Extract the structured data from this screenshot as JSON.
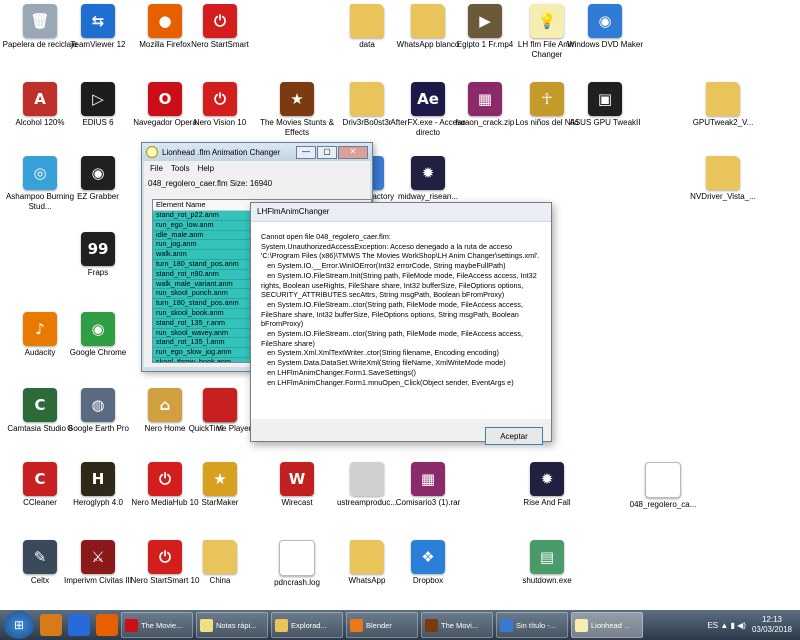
{
  "desktop_icons": [
    {
      "label": "Papelera de reciclaje",
      "color": "#9aa7b5",
      "glyph": "🗑",
      "col": 0,
      "row": 0,
      "shortcut": false
    },
    {
      "label": "TeamViewer 12",
      "color": "#1f6fd1",
      "glyph": "⇆",
      "col": 1,
      "row": 0,
      "shortcut": true
    },
    {
      "label": "Mozilla Firefox",
      "color": "#e66000",
      "glyph": "●",
      "col": 2,
      "row": 0,
      "shortcut": true
    },
    {
      "label": "Nero StartSmart",
      "color": "#d41d1d",
      "glyph": "⏻",
      "col": 3,
      "row": 0,
      "shortcut": true
    },
    {
      "label": "data",
      "color": "#e8c45a",
      "glyph": "",
      "col": 5,
      "row": 0,
      "folder": true
    },
    {
      "label": "WhatsApp blanco",
      "color": "#e8c45a",
      "glyph": "",
      "col": 6,
      "row": 0,
      "folder": true
    },
    {
      "label": "Egipto 1 Fr.mp4",
      "color": "#6b5a3a",
      "glyph": "▶",
      "col": 7,
      "row": 0
    },
    {
      "label": "LH flm File Anim Changer",
      "color": "#f5eeb0",
      "glyph": "💡",
      "col": 8,
      "row": 0
    },
    {
      "label": "Windows DVD Maker",
      "color": "#2f7bd6",
      "glyph": "◉",
      "col": 9,
      "row": 0,
      "shortcut": true
    },
    {
      "label": "Alcohol 120%",
      "color": "#c0302b",
      "glyph": "A",
      "col": 0,
      "row": 1,
      "shortcut": true
    },
    {
      "label": "EDIUS 6",
      "color": "#1d1d1d",
      "glyph": "▷",
      "col": 1,
      "row": 1,
      "shortcut": true
    },
    {
      "label": "Navegador Opera",
      "color": "#cc0f16",
      "glyph": "O",
      "col": 2,
      "row": 1,
      "shortcut": true
    },
    {
      "label": "Nero Vision 10",
      "color": "#d41d1d",
      "glyph": "⏻",
      "col": 3,
      "row": 1,
      "shortcut": true
    },
    {
      "label": "The Movies Stunts & Effects",
      "color": "#7b3a10",
      "glyph": "★",
      "col": 4,
      "row": 1,
      "shortcut": true
    },
    {
      "label": "Driv3rBo0st3r",
      "color": "#e8c45a",
      "glyph": "",
      "col": 5,
      "row": 1,
      "folder": true
    },
    {
      "label": "AfterFX.exe - Acceso directo",
      "color": "#1d1a4a",
      "glyph": "Ae",
      "col": 6,
      "row": 1,
      "shortcut": true
    },
    {
      "label": "faraon_crack.zip",
      "color": "#8a2a6a",
      "glyph": "▦",
      "col": 7,
      "row": 1
    },
    {
      "label": "Los niños del Nilo",
      "color": "#c49a2a",
      "glyph": "☥",
      "col": 8,
      "row": 1
    },
    {
      "label": "ASUS GPU TweakII",
      "color": "#202020",
      "glyph": "▣",
      "col": 9,
      "row": 1,
      "shortcut": true
    },
    {
      "label": "GPUTweak2_V...",
      "color": "#e8c45a",
      "glyph": "",
      "col": 11,
      "row": 1,
      "folder": true
    },
    {
      "label": "Ashampoo Burning Stud...",
      "color": "#3aa0d8",
      "glyph": "◎",
      "col": 0,
      "row": 2,
      "shortcut": true
    },
    {
      "label": "EZ Grabber",
      "color": "#202020",
      "glyph": "◉",
      "col": 1,
      "row": 2,
      "shortcut": true
    },
    {
      "label": "Format Factory",
      "color": "#3a7ad0",
      "glyph": "⚙",
      "col": 5,
      "row": 2,
      "shortcut": true
    },
    {
      "label": "midway_risean...",
      "color": "#202040",
      "glyph": "✹",
      "col": 6,
      "row": 2
    },
    {
      "label": "NVDriver_Vista_...",
      "color": "#e8c45a",
      "glyph": "",
      "col": 11,
      "row": 2,
      "folder": true
    },
    {
      "label": "Fraps",
      "color": "#202020",
      "glyph": "99",
      "col": 1,
      "row": 3,
      "shortcut": true
    },
    {
      "label": "Audacity",
      "color": "#e87a00",
      "glyph": "♪",
      "col": 0,
      "row": 4,
      "shortcut": true
    },
    {
      "label": "Google Chrome",
      "color": "#2f9e44",
      "glyph": "◉",
      "col": 1,
      "row": 4,
      "shortcut": true
    },
    {
      "label": "Camtasia Studio 8",
      "color": "#2d6a3a",
      "glyph": "C",
      "col": 0,
      "row": 5,
      "shortcut": true
    },
    {
      "label": "Google Earth Pro",
      "color": "#5a6a80",
      "glyph": "◍",
      "col": 1,
      "row": 5,
      "shortcut": true
    },
    {
      "label": "Nero Home",
      "color": "#d0a040",
      "glyph": "⌂",
      "col": 2,
      "row": 5,
      "shortcut": true
    },
    {
      "label": "QuickTime Player",
      "color": "#2a7ad8",
      "glyph": "Q",
      "col": 3,
      "row": 5,
      "shortcut": true
    },
    {
      "label": "CCleaner",
      "color": "#c82020",
      "glyph": "C",
      "col": 0,
      "row": 6,
      "shortcut": true
    },
    {
      "label": "Heroglyph 4.0",
      "color": "#302818",
      "glyph": "H",
      "col": 1,
      "row": 6,
      "shortcut": true
    },
    {
      "label": "Nero MediaHub 10",
      "color": "#d41d1d",
      "glyph": "⏻",
      "col": 2,
      "row": 6,
      "shortcut": true
    },
    {
      "label": "StarMaker",
      "color": "#d8a020",
      "glyph": "★",
      "col": 3,
      "row": 6,
      "shortcut": true
    },
    {
      "label": "Wirecast",
      "color": "#c02020",
      "glyph": "W",
      "col": 4,
      "row": 6,
      "shortcut": true
    },
    {
      "label": "ustreamproduc...",
      "color": "#d0d0d0",
      "glyph": "",
      "col": 5,
      "row": 6
    },
    {
      "label": "Comisario3 (1).rar",
      "color": "#8a2a6a",
      "glyph": "▦",
      "col": 6,
      "row": 6
    },
    {
      "label": "Rise And Fall",
      "color": "#202040",
      "glyph": "✹",
      "col": 8,
      "row": 6
    },
    {
      "label": "048_regolero_ca...",
      "color": "#ffffff",
      "glyph": "",
      "col": 10,
      "row": 6,
      "doc": true
    },
    {
      "label": "Celtx",
      "color": "#3a4a5a",
      "glyph": "✎",
      "col": 0,
      "row": 7,
      "shortcut": true
    },
    {
      "label": "Imperivm Civitas III",
      "color": "#8a1a1a",
      "glyph": "⚔",
      "col": 1,
      "row": 7,
      "shortcut": true
    },
    {
      "label": "Nero StartSmart 10",
      "color": "#d41d1d",
      "glyph": "⏻",
      "col": 2,
      "row": 7,
      "shortcut": true
    },
    {
      "label": "China",
      "color": "#e8c45a",
      "glyph": "",
      "col": 3,
      "row": 7,
      "folder": true
    },
    {
      "label": "pdncrash.log",
      "color": "#ffffff",
      "glyph": "",
      "col": 4,
      "row": 7,
      "doc": true
    },
    {
      "label": "WhatsApp",
      "color": "#e8c45a",
      "glyph": "",
      "col": 5,
      "row": 7,
      "folder": true
    },
    {
      "label": "Dropbox",
      "color": "#2a7fd8",
      "glyph": "❖",
      "col": 6,
      "row": 7
    },
    {
      "label": "shutdown.exe",
      "color": "#4a9a6a",
      "glyph": "▤",
      "col": 8,
      "row": 7
    }
  ],
  "partial_labels": [
    "Ne",
    "Ne",
    "Ne",
    "Vi"
  ],
  "lh_window": {
    "title": "Lionhead .flm Animation Changer",
    "menu": [
      "File",
      "Tools",
      "Help"
    ],
    "file_info": "048_regolero_caer.flm Size: 16940",
    "column_header": "Element Name",
    "rows": [
      "stand_rot_p22.anm",
      "run_ego_low.anm",
      "idle_male.anm",
      "run_jog.anm",
      "walk.anm",
      "turn_180_stand_pos.anm",
      "stand_rot_n90.anm",
      "walk_male_variant.anm",
      "run_skool_punch.anm",
      "turn_180_stand_pos.anm",
      "run_skool_book.anm",
      "stand_rot_135_r.anm",
      "run_skool_wavey.anm",
      "stand_rot_135_l.anm",
      "run_ego_slow_jog.anm",
      "skool_throw_book.anm",
      "stand_rot_p45.anm"
    ],
    "minimize": "—",
    "maximize": "▢",
    "close": "✕"
  },
  "error_dialog": {
    "title": "LHFlmAnimChanger",
    "message": "Cannot open file 048_regolero_caer.flm:\nSystem.UnauthorizedAccessException: Acceso denegado a la ruta de acceso 'C:\\Program Files (x86)\\TMWS The Movies WorkShop\\LH Anim Changer\\settings.xml'.\n   en System.IO.__Error.WinIOError(Int32 errorCode, String maybeFullPath)\n   en System.IO.FileStream.Init(String path, FileMode mode, FileAccess access, Int32 rights, Boolean useRights, FileShare share, Int32 bufferSize, FileOptions options, SECURITY_ATTRIBUTES secAttrs, String msgPath, Boolean bFromProxy)\n   en System.IO.FileStream..ctor(String path, FileMode mode, FileAccess access, FileShare share, Int32 bufferSize, FileOptions options, String msgPath, Boolean bFromProxy)\n   en System.IO.FileStream..ctor(String path, FileMode mode, FileAccess access, FileShare share)\n   en System.Xml.XmlTextWriter..ctor(String filename, Encoding encoding)\n   en System.Data.DataSet.WriteXml(String fileName, XmlWriteMode mode)\n   en LHFlmAnimChanger.Form1.SaveSettings()\n   en LHFlmAnimChanger.Form1.mnuOpen_Click(Object sender, EventArgs e)",
    "accept_label": "Aceptar"
  },
  "taskbar": {
    "start_glyph": "⊞",
    "pinned": [
      {
        "color": "#d87a1a"
      },
      {
        "color": "#2a6ad8"
      },
      {
        "color": "#e66000"
      }
    ],
    "tasks": [
      {
        "label": "The Movie...",
        "color": "#cc0f16",
        "active": false
      },
      {
        "label": "Notas rápi...",
        "color": "#f0e080",
        "active": false
      },
      {
        "label": "Explorad...",
        "color": "#e8c45a",
        "active": false
      },
      {
        "label": "Blender",
        "color": "#e87a1a",
        "active": false
      },
      {
        "label": "The Movi...",
        "color": "#7b3a10",
        "active": false
      },
      {
        "label": "Sin título -...",
        "color": "#3a7ad0",
        "active": false
      },
      {
        "label": "Lionhead ...",
        "color": "#f5eeb0",
        "active": true
      }
    ],
    "tray_icons": "ES ▲ ▮ ◀)",
    "time": "12:13",
    "date": "03/03/2018"
  }
}
